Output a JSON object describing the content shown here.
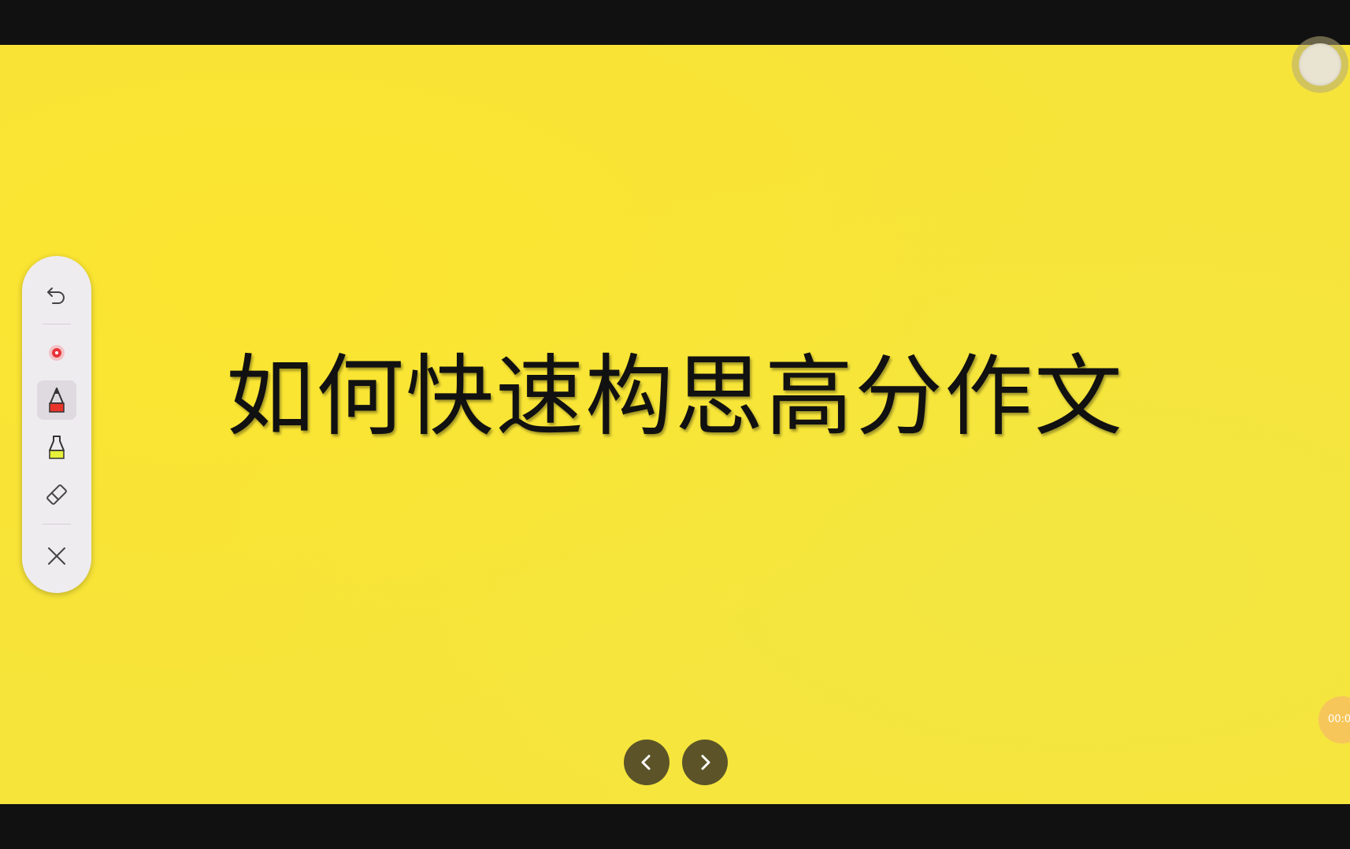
{
  "slide": {
    "title": "如何快速构思高分作文",
    "background_color": "#f7e43a"
  },
  "toolbar": {
    "tools": [
      {
        "name": "undo",
        "icon": "undo-icon"
      },
      {
        "name": "laser-pointer",
        "icon": "laser-pointer-icon",
        "color": "#e8343a"
      },
      {
        "name": "pen",
        "icon": "pen-icon",
        "color": "#e8342a",
        "active": true
      },
      {
        "name": "highlighter",
        "icon": "highlighter-icon",
        "color": "#e6ef3a"
      },
      {
        "name": "eraser",
        "icon": "eraser-icon"
      },
      {
        "name": "close",
        "icon": "close-icon"
      }
    ]
  },
  "timer": {
    "text": "00:0"
  },
  "navigation": {
    "prev_icon": "chevron-left-icon",
    "next_icon": "chevron-right-icon"
  }
}
